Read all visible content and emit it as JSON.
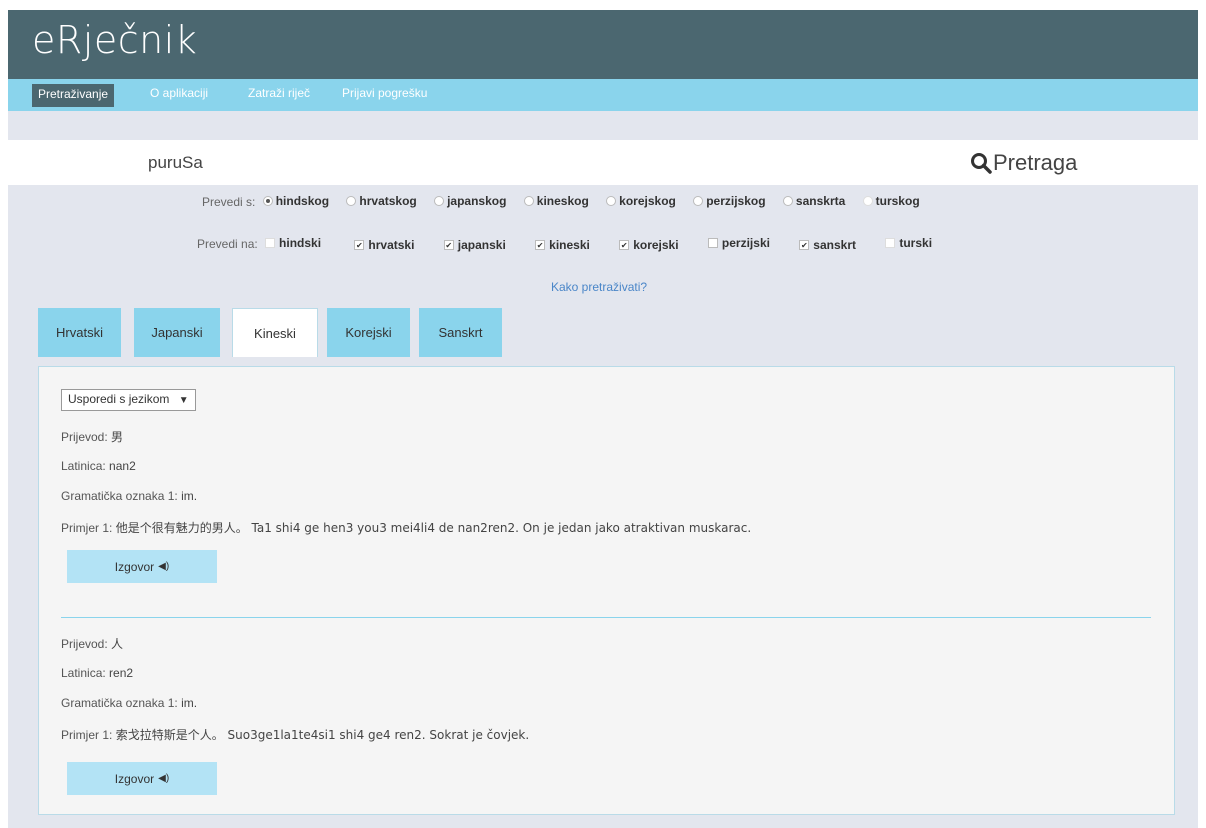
{
  "app": {
    "title": "eRječnik"
  },
  "nav": [
    {
      "label": "Pretraživanje",
      "active": true
    },
    {
      "label": "O aplikaciji"
    },
    {
      "label": "Zatraži riječ"
    },
    {
      "label": "Prijavi pogrešku"
    }
  ],
  "search": {
    "value": "puruSa",
    "button_label": "Pretraga",
    "icon": "search-icon"
  },
  "from": {
    "label": "Prevedi s:",
    "options": [
      {
        "label": "hindskog",
        "checked": true
      },
      {
        "label": "hrvatskog"
      },
      {
        "label": "japanskog"
      },
      {
        "label": "kineskog"
      },
      {
        "label": "korejskog"
      },
      {
        "label": "perzijskog"
      },
      {
        "label": "sanskrta"
      },
      {
        "label": "turskog"
      }
    ]
  },
  "to": {
    "label": "Prevedi na:",
    "options": [
      {
        "label": "hindski",
        "checked": false,
        "disabled": true
      },
      {
        "label": "hrvatski",
        "checked": true
      },
      {
        "label": "japanski",
        "checked": true
      },
      {
        "label": "kineski",
        "checked": true
      },
      {
        "label": "korejski",
        "checked": true
      },
      {
        "label": "perzijski",
        "checked": false
      },
      {
        "label": "sanskrt",
        "checked": true
      },
      {
        "label": "turski",
        "checked": false,
        "disabled": true
      }
    ]
  },
  "howto": "Kako pretraživati?",
  "tabs": [
    {
      "label": "Hrvatski"
    },
    {
      "label": "Japanski"
    },
    {
      "label": "Kineski",
      "active": true
    },
    {
      "label": "Korejski"
    },
    {
      "label": "Sanskrt"
    }
  ],
  "compare": {
    "label": "Usporedi s jezikom",
    "arrow": "▼"
  },
  "entries": [
    {
      "prijevod_key": "Prijevod:",
      "prijevod": "男",
      "latinica_key": "Latinica:",
      "latinica": "nan2",
      "oznaka_key": "Gramatička oznaka 1:",
      "oznaka": "im.",
      "primjer_key": "Primjer 1:",
      "primjer": "他是个很有魅力的男人。 Ta1 shi4 ge hen3 you3 mei4li4 de nan2ren2. On je jedan jako atraktivan muskarac.",
      "button": "Izgovor"
    },
    {
      "prijevod_key": "Prijevod:",
      "prijevod": "人",
      "latinica_key": "Latinica:",
      "latinica": "ren2",
      "oznaka_key": "Gramatička oznaka 1:",
      "oznaka": "im.",
      "primjer_key": "Primjer 1:",
      "primjer": "索戈拉特斯是个人。 Suo3ge1la1te4si1 shi4 ge4 ren2. Sokrat je čovjek.",
      "button": "Izgovor"
    }
  ],
  "colors": {
    "header": "#4b6770",
    "nav": "#8ad4ec",
    "background": "#e3e6ee",
    "link": "#4a86c8"
  }
}
